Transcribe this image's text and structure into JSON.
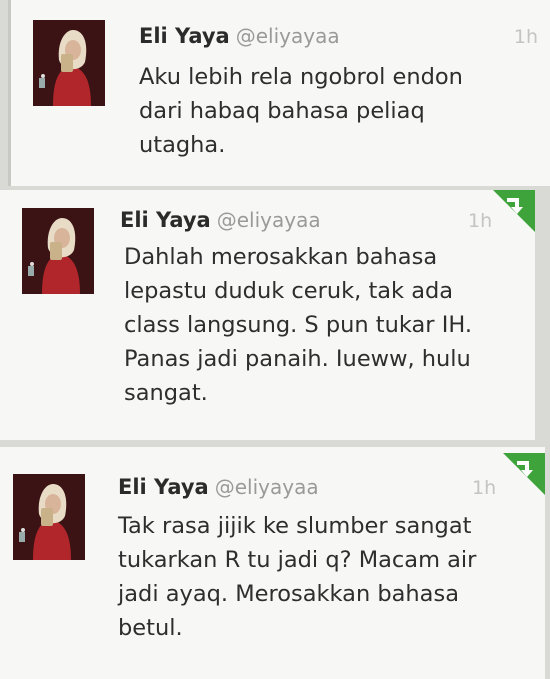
{
  "tweets": [
    {
      "name": "Eli Yaya",
      "handle": "@eliyayaa",
      "time": "1h",
      "lines": [
        "Aku lebih rela ngobrol endon",
        "dari habaq bahasa peliaq",
        "utagha."
      ]
    },
    {
      "name": "Eli Yaya",
      "handle": "@eliyayaa",
      "time": "1h",
      "lines": [
        "Dahlah merosakkan bahasa",
        "lepastu duduk ceruk, tak ada",
        "class langsung. S pun tukar IH.",
        "Panas jadi panaih. Iueww, hulu",
        "sangat."
      ]
    },
    {
      "name": "Eli Yaya",
      "handle": "@eliyayaa",
      "time": "1h",
      "lines": [
        "Tak rasa jijik ke slumber sangat",
        "tukarkan R tu jadi q? Macam air",
        "jadi ayaq. Merosakkan bahasa",
        "betul."
      ]
    }
  ],
  "icons": {
    "avatar": "profile-photo",
    "retweet": "retweet-icon"
  },
  "colors": {
    "retweet_green": "#3fa33b",
    "handle_gray": "#9a9a9a",
    "card_bg": "#f7f7f5"
  }
}
